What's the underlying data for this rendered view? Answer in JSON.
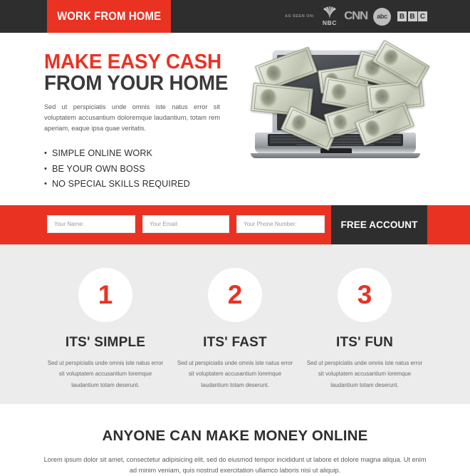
{
  "header": {
    "logo": "WORK FROM HOME",
    "as_seen_on_label": "AS SEEN ON:",
    "brands": [
      {
        "name": "NBC",
        "label": "NBC"
      },
      {
        "name": "CNN",
        "label": "CNN"
      },
      {
        "name": "abc",
        "label": "abc"
      },
      {
        "name": "BBC",
        "letters": [
          "B",
          "B",
          "C"
        ]
      }
    ]
  },
  "hero": {
    "headline_line1": "MAKE EASY CASH",
    "headline_line2": "FROM YOUR HOME",
    "paragraph": "Sed ut perspiciatis unde omnis iste natus error sit voluptatem accusantium doloremque laudantium, totam rem aperiam, eaque ipsa quae veritatis.",
    "bullets": [
      "SIMPLE ONLINE WORK",
      "BE YOUR OWN BOSS",
      "NO SPECIAL SKILLS REQUIRED"
    ],
    "image_alt": "laptop-with-flying-dollar-bills"
  },
  "form": {
    "name_placeholder": "Your Name:",
    "email_placeholder": "Your Email:",
    "phone_placeholder": "Your Phone Number:",
    "name_value": "",
    "email_value": "",
    "phone_value": "",
    "submit_label": "FREE ACCOUNT"
  },
  "features": [
    {
      "number": "1",
      "title": "ITS' SIMPLE",
      "text": "Sed ut perspiciatis unde omnis iste natus error sit voluptatem accusantium loremque laudantium totam deserunt."
    },
    {
      "number": "2",
      "title": "ITS' FAST",
      "text": "Sed ut perspiciatis unde omnis iste natus error sit voluptatem accusantium loremque laudantium totam deserunt."
    },
    {
      "number": "3",
      "title": "ITS' FUN",
      "text": "Sed ut perspiciatis unde omnis iste natus error sit voluptatem accusantium loremque laudantium totam deserunt."
    }
  ],
  "footer": {
    "title": "ANYONE CAN MAKE MONEY ONLINE",
    "text": "Lorem ipsum dolor sit amet, consectetur adipisicing elit, sed do eiusmod tempor incididunt ut labore et dolore magna aliqua. Ut enim ad minim veniam, quis nostrud exercitation ullamco laboris nisi ut aliquip."
  },
  "colors": {
    "accent_red": "#ea3223",
    "dark": "#2e2e2e",
    "feature_bg": "#ececec",
    "body_text": "#5c5c5c"
  }
}
